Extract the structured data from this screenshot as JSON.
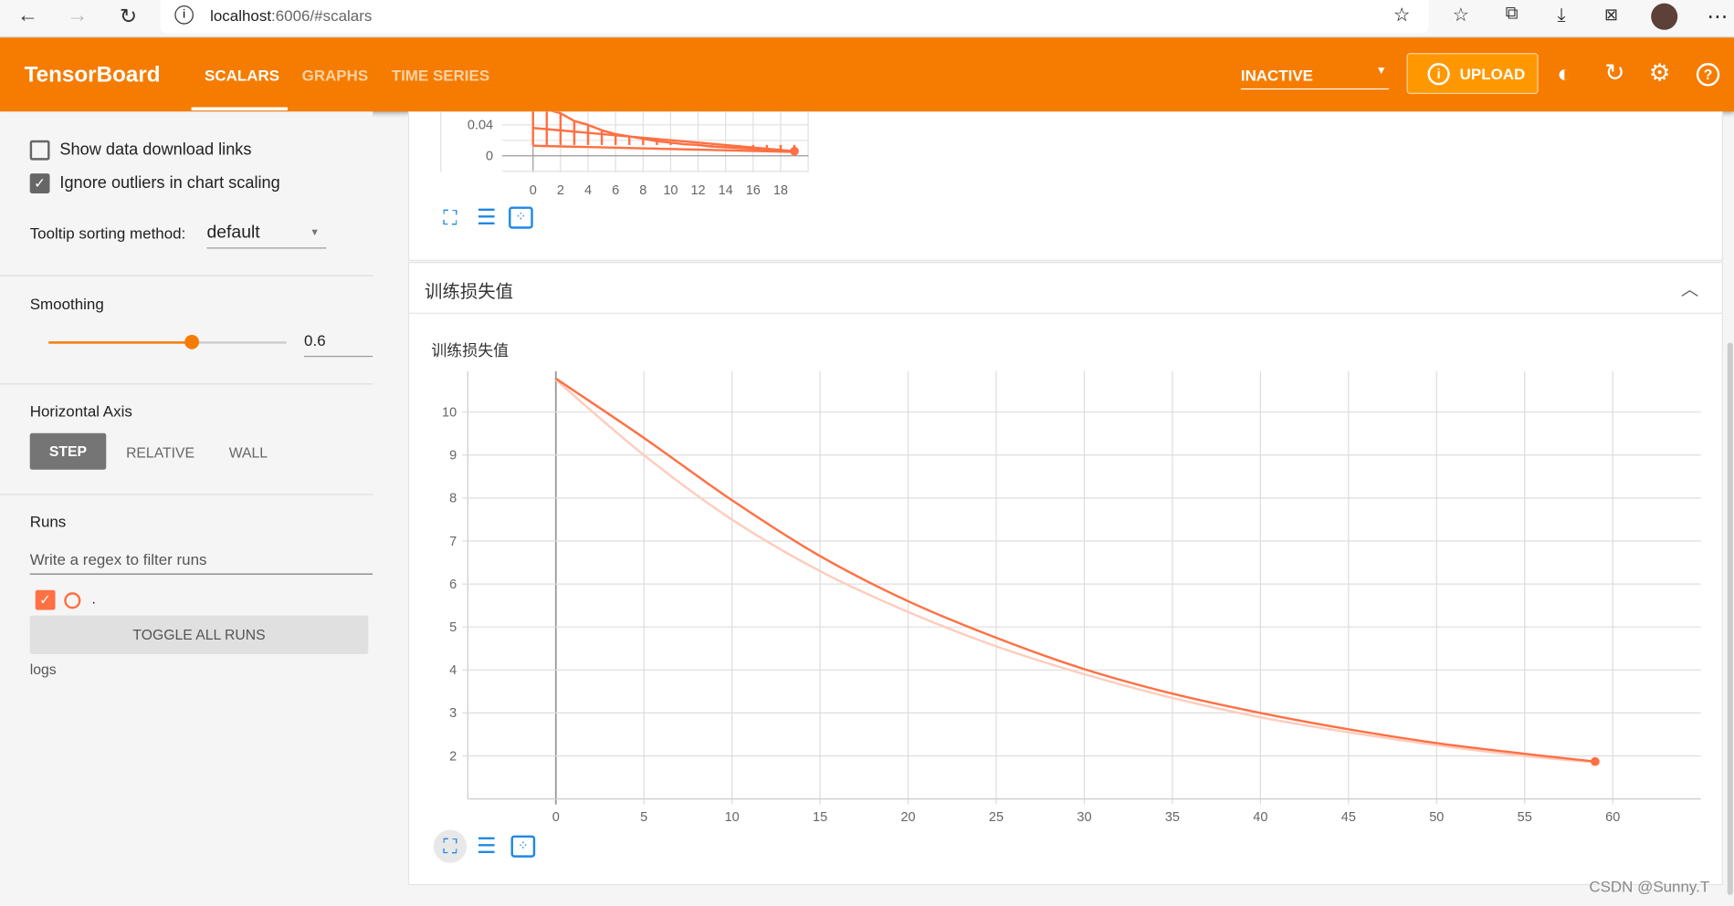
{
  "browser": {
    "url_host": "localhost",
    "url_rest": ":6006/#scalars",
    "icons": [
      "back-icon",
      "forward-icon",
      "reload-icon",
      "info-icon",
      "favorite-add-icon",
      "favorites-icon",
      "collections-icon",
      "download-icon",
      "math-solver-icon",
      "avatar",
      "more-icon"
    ]
  },
  "header": {
    "title": "TensorBoard",
    "tabs": [
      {
        "label": "SCALARS",
        "active": true
      },
      {
        "label": "GRAPHS"
      },
      {
        "label": "TIME SERIES"
      }
    ],
    "run_select": "INACTIVE",
    "upload_label": "UPLOAD",
    "color": "#f57c00"
  },
  "sidebar": {
    "show_download": "Show data download links",
    "show_download_checked": false,
    "ignore_outliers": "Ignore outliers in chart scaling",
    "ignore_outliers_checked": true,
    "tooltip_label": "Tooltip sorting method:",
    "tooltip_value": "default",
    "smoothing_label": "Smoothing",
    "smoothing_value": "0.6",
    "smoothing_fraction": 0.6,
    "axis_label": "Horizontal Axis",
    "axis_options": [
      "STEP",
      "RELATIVE",
      "WALL"
    ],
    "axis_selected": "STEP",
    "runs_label": "Runs",
    "runs_filter_placeholder": "Write a regex to filter runs",
    "run_name": ".",
    "toggle_all": "TOGGLE ALL RUNS",
    "logs_label": "logs"
  },
  "section": {
    "title": "训练损失值"
  },
  "watermark": "CSDN @Sunny.T",
  "chart_data": [
    {
      "type": "line",
      "title": "",
      "x_ticks": [
        "0",
        "2",
        "4",
        "6",
        "8",
        "10",
        "12",
        "14",
        "16",
        "18"
      ],
      "y_ticks": [
        "0",
        "0.04"
      ],
      "series": [
        {
          "x": [
            0,
            1,
            2,
            3,
            4,
            5,
            6,
            7,
            8,
            9,
            10,
            11,
            12,
            13,
            14,
            15,
            16,
            17,
            18,
            19
          ],
          "values": [
            0.065,
            0.06,
            0.055,
            0.045,
            0.04,
            0.033,
            0.028,
            0.025,
            0.022,
            0.019,
            0.017,
            0.015,
            0.014,
            0.012,
            0.011,
            0.01,
            0.009,
            0.008,
            0.007,
            0.006
          ]
        }
      ],
      "color": "#ff7043",
      "partial": true
    },
    {
      "type": "line",
      "title": "训练损失值",
      "xlim": [
        -5,
        65
      ],
      "ylim": [
        1,
        10.95
      ],
      "x_ticks": [
        0,
        5,
        10,
        15,
        20,
        25,
        30,
        35,
        40,
        45,
        50,
        55,
        60
      ],
      "y_ticks": [
        2,
        3,
        4,
        5,
        6,
        7,
        8,
        9,
        10
      ],
      "grid": true,
      "series": [
        {
          "kind": "smoothed",
          "color": "#ff7043",
          "x": [
            0,
            5,
            10,
            15,
            20,
            25,
            30,
            35,
            40,
            45,
            50,
            55,
            59
          ],
          "values": [
            10.78,
            9.4,
            7.95,
            6.65,
            5.6,
            4.75,
            4.02,
            3.45,
            3.0,
            2.62,
            2.3,
            2.05,
            1.87
          ]
        },
        {
          "kind": "raw",
          "color": "#ffccbc",
          "x": [
            0,
            5,
            10,
            15,
            20,
            25,
            30,
            35,
            40,
            45,
            50,
            55,
            59
          ],
          "values": [
            10.75,
            9.0,
            7.5,
            6.3,
            5.35,
            4.55,
            3.9,
            3.35,
            2.9,
            2.55,
            2.25,
            2.0,
            1.85
          ]
        }
      ]
    }
  ]
}
